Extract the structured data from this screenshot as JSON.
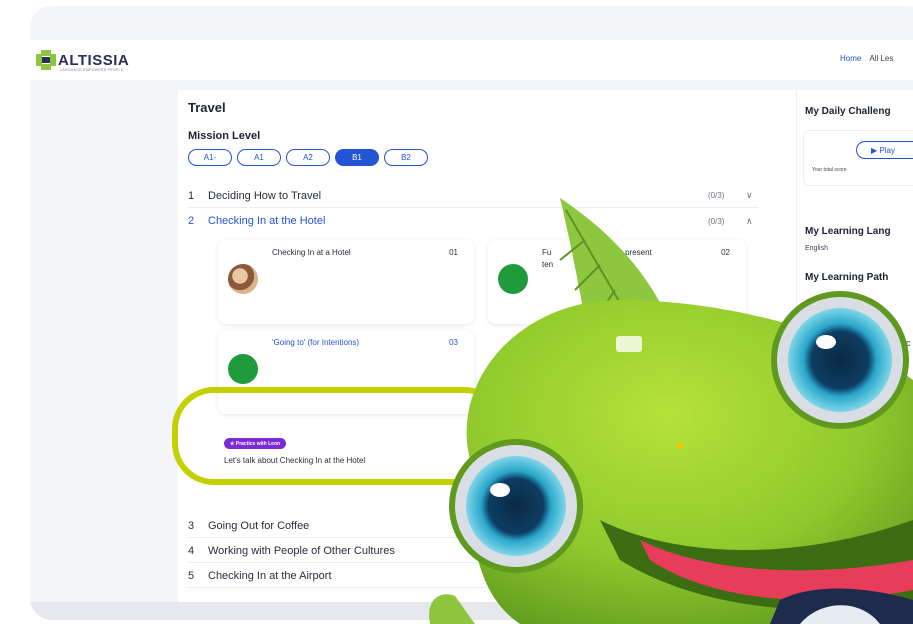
{
  "brand": {
    "name": "ALTISSIA",
    "tagline": "LANGUAGE EMPOWERS PEOPLE"
  },
  "nav": {
    "home": "Home",
    "all_lessons": "All Les"
  },
  "course": {
    "title": "Travel",
    "mission_level_label": "Mission Level",
    "levels": [
      "A1-",
      "A1",
      "A2",
      "B1",
      "B2"
    ],
    "active_level": "B1",
    "chapters": [
      {
        "num": "1",
        "title": "Deciding How to Travel",
        "progress": "(0/3)",
        "chevron": "∨"
      },
      {
        "num": "2",
        "title": "Checking In at the Hotel",
        "progress": "(0/3)",
        "chevron": "∧"
      },
      {
        "num": "3",
        "title": "Going Out for Coffee"
      },
      {
        "num": "4",
        "title": "Working with People of Other Cultures"
      },
      {
        "num": "5",
        "title": "Checking In at the Airport"
      }
    ],
    "lessons": [
      {
        "title": "Checking In at a Hotel",
        "num": "01"
      },
      {
        "title_a": "Fu",
        "title_b": "n' + present",
        "title_line2": "ten",
        "num": "02"
      },
      {
        "title": "'Going to' (for Intentions)",
        "num": "03"
      }
    ],
    "practice": {
      "badge": "★ Practice with Leon",
      "text": "Let's talk about Checking In at the Hotel"
    }
  },
  "sidebar": {
    "daily_challenge": "My Daily Challeng",
    "play_label": "▶  Play",
    "score_text": "Your total score",
    "learning_language_title": "My Learning Lang",
    "learning_language_value": "English",
    "learning_path_title": "My Learning Path",
    "partial_text": "nc"
  },
  "colors": {
    "accent": "#2454d6",
    "practice_badge": "#7a2bd6",
    "highlight_ring": "#c3d100",
    "mascot_green": "#8dc63f"
  }
}
